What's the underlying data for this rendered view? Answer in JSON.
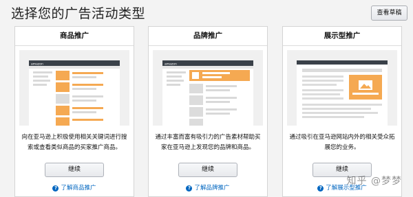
{
  "header": {
    "title": "选择您的广告活动类型",
    "draft_button": "查看草稿"
  },
  "cards": [
    {
      "title": "商品推广",
      "description": "向在亚马逊上积极使用相关关键词进行搜索或查看类似商品的买家推广商品。",
      "button": "继续",
      "learn_more": "了解商品推广"
    },
    {
      "title": "品牌推广",
      "description": "通过丰富而富有吸引力的广告素材帮助买家在亚马逊上发现您的品牌和商品。",
      "button": "继续",
      "learn_more": "了解品牌推广"
    },
    {
      "title": "展示型推广",
      "description": "通过吸引在亚马逊网站内外的相关受众拓展您的业务。",
      "button": "继续",
      "learn_more": "了解展示型推广"
    }
  ],
  "illustration_brand_text": "amazon",
  "watermark": "知乎 @梦梦",
  "colors": {
    "accent_orange": "#f5a952",
    "link_blue": "#0066c0",
    "navbar_dark": "#3a4149"
  }
}
